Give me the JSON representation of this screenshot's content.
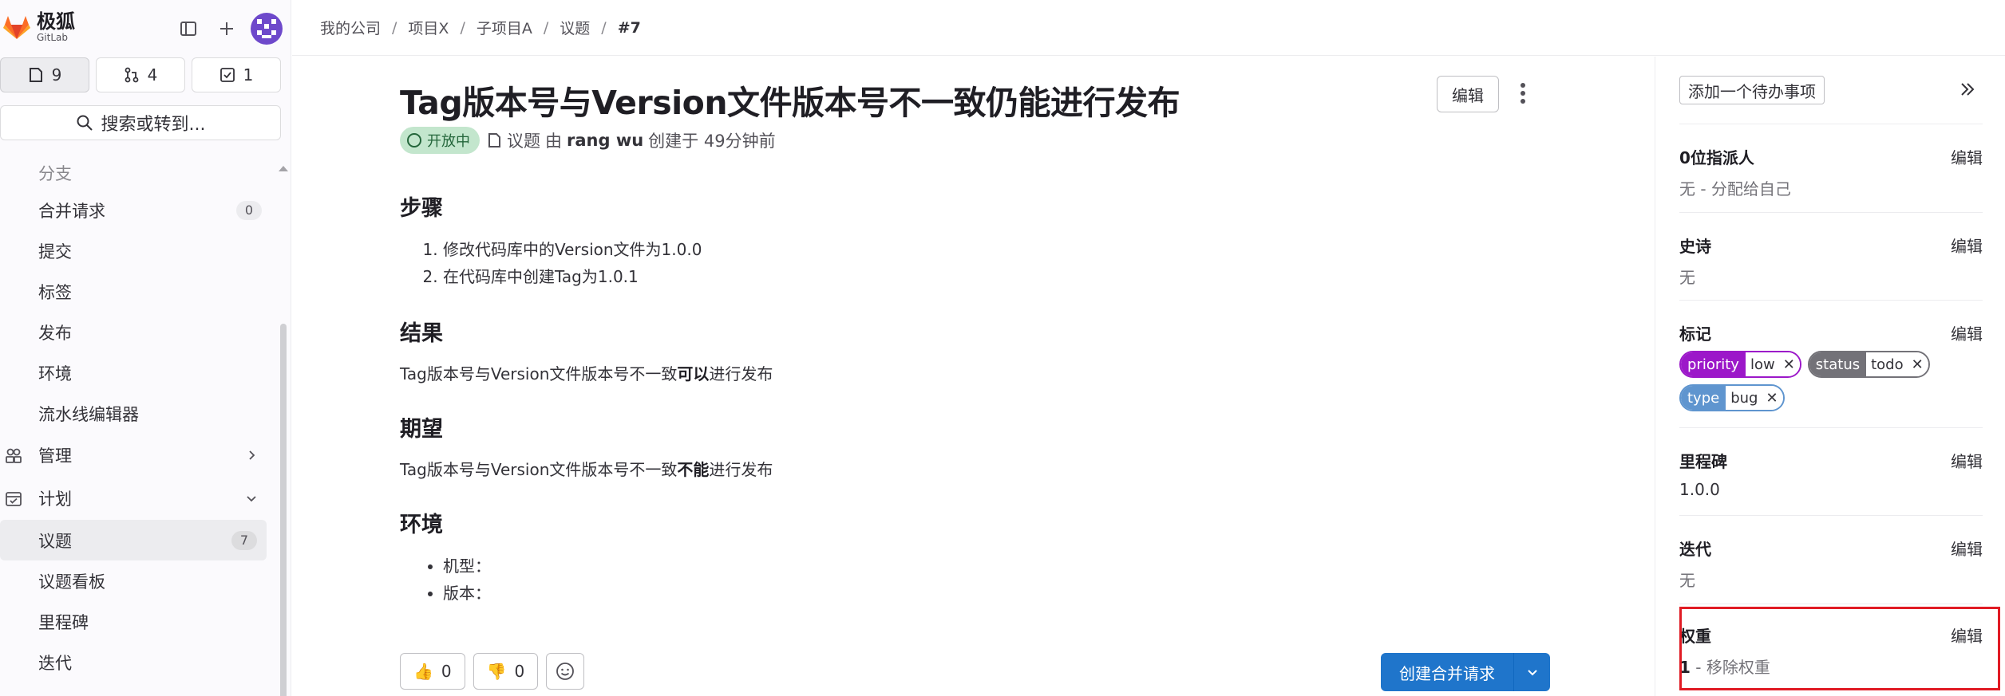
{
  "app": {
    "brand_cn": "极狐",
    "brand_en": "GitLab"
  },
  "colors": {
    "accent": "#1f75cb",
    "status_open_bg": "#c3e6cd",
    "highlight": "#e01b24",
    "priority": "#9c18c9",
    "status_label": "#737278",
    "type_label": "#5f95cf"
  },
  "counts": {
    "issues": "9",
    "merge_requests": "4",
    "todos": "1"
  },
  "search": {
    "label": "搜索或转到..."
  },
  "nav": {
    "branches": "分支",
    "merge_requests": "合并请求",
    "merge_requests_count": "0",
    "commits": "提交",
    "tags": "标签",
    "releases": "发布",
    "environments": "环境",
    "pipeline_editor": "流水线编辑器",
    "manage": "管理",
    "plan": "计划",
    "issues": "议题",
    "issues_count": "7",
    "issue_boards": "议题看板",
    "milestones": "里程碑",
    "iterations": "迭代"
  },
  "breadcrumb": [
    "我的公司",
    "项目X",
    "子项目A",
    "议题",
    "#7"
  ],
  "issue": {
    "title": "Tag版本号与Version文件版本号不一致仍能进行发布",
    "edit_label": "编辑",
    "status": "开放中",
    "type": "议题",
    "by": "由",
    "author": "rang wu",
    "created": "创建于 49分钟前"
  },
  "content": {
    "steps_title": "步骤",
    "steps": [
      "修改代码库中的Version文件为1.0.0",
      "在代码库中创建Tag为1.0.1"
    ],
    "result_title": "结果",
    "result_pre": "Tag版本号与Version文件版本号不一致",
    "result_bold": "可以",
    "result_post": "进行发布",
    "expect_title": "期望",
    "expect_pre": "Tag版本号与Version文件版本号不一致",
    "expect_bold": "不能",
    "expect_post": "进行发布",
    "env_title": "环境",
    "env_items": [
      "机型：",
      "版本："
    ]
  },
  "reactions": {
    "thumbs_up": "0",
    "thumbs_down": "0"
  },
  "create_mr": "创建合并请求",
  "sidebar": {
    "add_todo": "添加一个待办事项",
    "edit": "编辑",
    "assignees_label": "0位指派人",
    "assignees_value": "无 - 分配给自己",
    "epic_label": "史诗",
    "epic_value": "无",
    "labels_label": "标记",
    "labels": [
      {
        "key": "priority",
        "value": "low"
      },
      {
        "key": "status",
        "value": "todo"
      },
      {
        "key": "type",
        "value": "bug"
      }
    ],
    "milestone_label": "里程碑",
    "milestone_value": "1.0.0",
    "iteration_label": "迭代",
    "iteration_value": "无",
    "weight_label": "权重",
    "weight_value": "1",
    "weight_sep": " - ",
    "weight_remove": "移除权重"
  }
}
